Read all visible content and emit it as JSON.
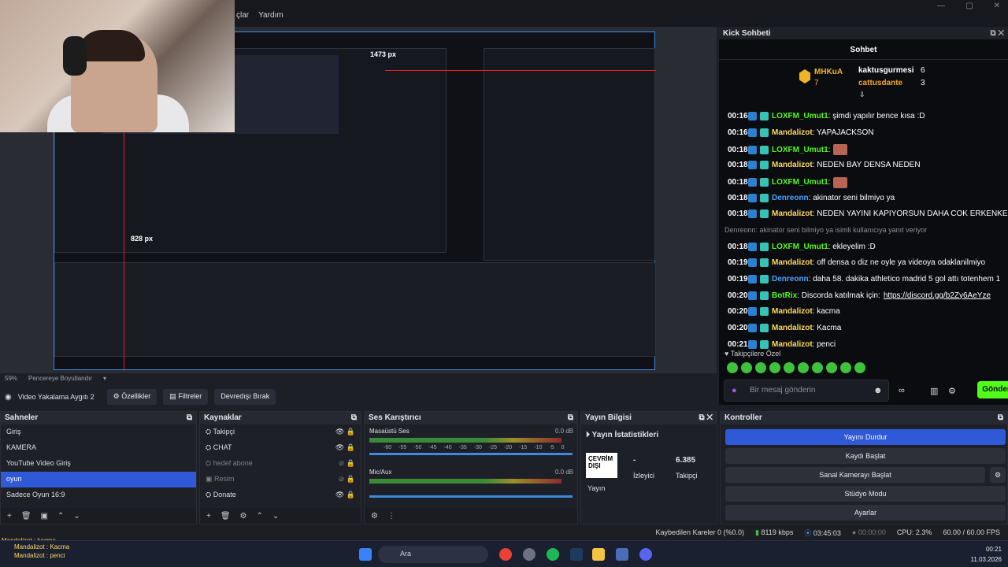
{
  "menu": {
    "items": [
      "çlar",
      "Yardım"
    ]
  },
  "preview": {
    "zoom": "59%",
    "fit_label": "Pencereye Boyutlandır",
    "nested_px_1": "1473 px",
    "nested_px_2": "828 px"
  },
  "source_toolbar": {
    "source_name": "Video Yakalama Aygıtı 2",
    "properties": "Özellikler",
    "filters": "Filtreler",
    "deactivate": "Devredışı Bırak"
  },
  "chat": {
    "panel_title": "Kick Sohbeti",
    "tab": "Sohbet",
    "leaders": [
      {
        "name": "MHKuA",
        "count": "7"
      },
      {
        "name": "kaktusgurmesi",
        "count": "6"
      },
      {
        "name": "cattusdante",
        "count": "3"
      }
    ],
    "messages": [
      {
        "time": "00:16",
        "user": "LOXFM_Umut1",
        "color": "#53fc18",
        "text": ": şimdi yapılır bence kısa :D"
      },
      {
        "time": "00:16",
        "user": "Mandalizot",
        "color": "#ffd860",
        "text": ": YAPAJACKSON"
      },
      {
        "time": "00:18",
        "user": "LOXFM_Umut1",
        "color": "#53fc18",
        "text": ":",
        "emote": true
      },
      {
        "time": "00:18",
        "user": "Mandalizot",
        "color": "#ffd860",
        "text": ": NEDEN BAY DENSA NEDEN"
      },
      {
        "time": "00:18",
        "user": "LOXFM_Umut1",
        "color": "#53fc18",
        "text": ":",
        "emote": true
      },
      {
        "time": "00:18",
        "user": "Denreonn",
        "color": "#4aa3ff",
        "text": ": akinator seni bilmiyo ya"
      },
      {
        "time": "00:18",
        "user": "Mandalizot",
        "color": "#ffd860",
        "text": ": NEDEN YAYINI KAPIYORSUN DAHA COK ERKENKEN"
      },
      {
        "time": "",
        "user": "",
        "color": "#8b8f99",
        "text": "Denreonn: akinator seni bilmiyo ya isimli kullanıcıya yanıt veriyor"
      },
      {
        "time": "00:18",
        "user": "LOXFM_Umut1",
        "color": "#53fc18",
        "text": ": ekleyelim :D"
      },
      {
        "time": "00:19",
        "user": "Mandalizot",
        "color": "#ffd860",
        "text": ": off densa o diz ne oyle ya videoya odaklanilmiyo"
      },
      {
        "time": "00:19",
        "user": "Denreonn",
        "color": "#4aa3ff",
        "text": ": daha 58. dakika athletico madrid 5 gol attı totenhem 1"
      },
      {
        "time": "00:20",
        "user": "BotRix",
        "color": "#53fc18",
        "text": ": Discorda katılmak için: ",
        "link": "https://discord.gg/b2Zy6AeYze"
      },
      {
        "time": "00:20",
        "user": "Mandalizot",
        "color": "#ffd860",
        "text": ": kacma"
      },
      {
        "time": "00:20",
        "user": "Mandalizot",
        "color": "#ffd860",
        "text": ": Kacma"
      },
      {
        "time": "00:21",
        "user": "Mandalizot",
        "color": "#ffd860",
        "text": ": penci"
      }
    ],
    "followers_label": "Takipçilere Özel",
    "input_placeholder": "Bir mesaj gönderin",
    "send": "Gönder"
  },
  "scenes": {
    "title": "Sahneler",
    "items": [
      "Giriş",
      "KAMERA",
      "YouTube Video Giriş",
      "oyun",
      "Sadece Oyun 16:9"
    ],
    "selected": 3
  },
  "sources": {
    "title": "Kaynaklar",
    "items": [
      "Takipçi",
      "CHAT",
      "hedef abone",
      "Resim",
      "Donate"
    ]
  },
  "mixer": {
    "title": "Ses Karıştırıcı",
    "channels": [
      {
        "name": "Masaüstü Ses",
        "db": "0.0 dB"
      },
      {
        "name": "Mic/Aux",
        "db": "0.0 dB"
      }
    ],
    "scale": [
      "-60",
      "-55",
      "-50",
      "-45",
      "-40",
      "-35",
      "-30",
      "-25",
      "-20",
      "-15",
      "-10",
      "-5",
      "0"
    ]
  },
  "stream_info": {
    "title": "Yayın Bilgisi",
    "stats_title": "Yayın İstatistikleri",
    "status": "ÇEVRİM DIŞI",
    "status_label": "Yayın",
    "viewers": "-",
    "viewers_label": "İzleyici",
    "followers": "6.385",
    "followers_label": "Takipçi"
  },
  "controls": {
    "title": "Kontroller",
    "buttons": [
      "Yayını Durdur",
      "Kaydı Başlat",
      "Sanal Kamerayı Başlat",
      "Stüdyo Modu",
      "Ayarlar"
    ]
  },
  "status": {
    "dropped": "Kaybedilen Kareler 0 (%0.0)",
    "bitrate": "8119 kbps",
    "stream_time": "03:45:03",
    "rec_time": "00:00:00",
    "cpu": "CPU: 2.3%",
    "fps": "60.00 / 60.00 FPS"
  },
  "taskbar": {
    "search": "Ara",
    "time": "00:21",
    "date": "11.03.2026"
  },
  "mini_chat": [
    "Mandalizot : kacma",
    "Mandalizot : Kacma",
    "Mandalizot : penci"
  ]
}
